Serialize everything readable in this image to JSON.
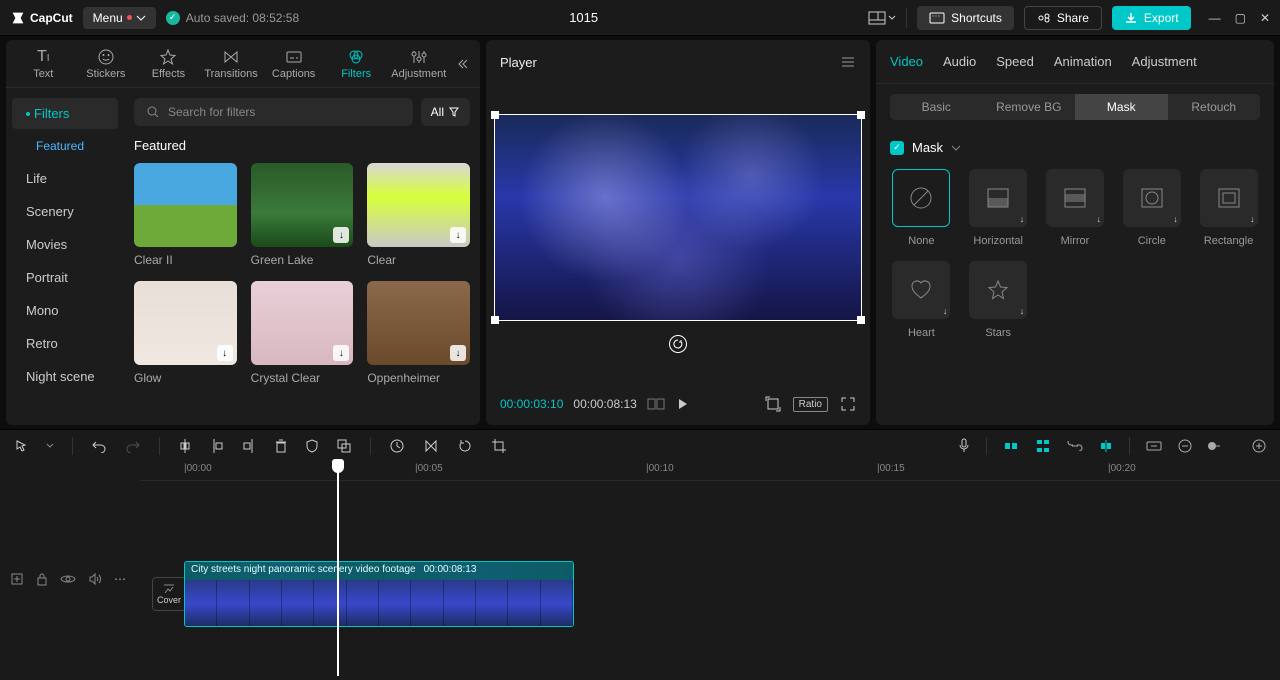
{
  "topbar": {
    "app_name": "CapCut",
    "menu_label": "Menu",
    "autosave_label": "Auto saved: 08:52:58",
    "project_title": "1015",
    "shortcuts_label": "Shortcuts",
    "share_label": "Share",
    "export_label": "Export"
  },
  "media_tabs": [
    {
      "label": "Text"
    },
    {
      "label": "Stickers"
    },
    {
      "label": "Effects"
    },
    {
      "label": "Transitions"
    },
    {
      "label": "Captions"
    },
    {
      "label": "Filters"
    },
    {
      "label": "Adjustment"
    }
  ],
  "filter_categories": {
    "main": "Filters",
    "items": [
      "Featured",
      "Life",
      "Scenery",
      "Movies",
      "Portrait",
      "Mono",
      "Retro",
      "Night scene"
    ]
  },
  "search": {
    "placeholder": "Search for filters",
    "all_label": "All"
  },
  "filter_section_title": "Featured",
  "filters": [
    {
      "name": "Clear II",
      "bg": "linear-gradient(180deg,#4aa8e0 0%,#4aa8e0 50%,#6daa3a 50%,#6daa3a 100%)",
      "dl": false
    },
    {
      "name": "Green Lake",
      "bg": "linear-gradient(180deg,#2a5a2a 0%,#3a7a3a 60%,#1a4a1a 100%)",
      "dl": true
    },
    {
      "name": "Clear",
      "bg": "linear-gradient(180deg,#d8d8d8 0%,#d8ff3a 40%,#c8c8c8 100%)",
      "dl": true
    },
    {
      "name": "Glow",
      "bg": "linear-gradient(180deg,#e8e0d8 0%,#f0e8e0 100%)",
      "dl": true
    },
    {
      "name": "Crystal Clear",
      "bg": "linear-gradient(180deg,#e8d0d8 0%,#d8b8c0 100%)",
      "dl": true
    },
    {
      "name": "Oppenheimer",
      "bg": "linear-gradient(180deg,#8a6a4a 0%,#6a4a2a 100%)",
      "dl": true
    }
  ],
  "player": {
    "title": "Player",
    "current_time": "00:00:03:10",
    "total_time": "00:00:08:13",
    "ratio_label": "Ratio"
  },
  "right_panel": {
    "tabs": [
      "Video",
      "Audio",
      "Speed",
      "Animation",
      "Adjustment"
    ],
    "subtabs": [
      "Basic",
      "Remove BG",
      "Mask",
      "Retouch"
    ],
    "mask_label": "Mask",
    "mask_shapes": [
      {
        "name": "None",
        "active": true
      },
      {
        "name": "Horizontal"
      },
      {
        "name": "Mirror"
      },
      {
        "name": "Circle"
      },
      {
        "name": "Rectangle"
      },
      {
        "name": "Heart"
      },
      {
        "name": "Stars"
      }
    ]
  },
  "timeline": {
    "marks": [
      "00:00",
      "00:05",
      "00:10",
      "00:15",
      "00:20"
    ],
    "cover_label": "Cover",
    "clip": {
      "title": "City streets night panoramic scenery video footage",
      "duration": "00:00:08:13"
    }
  }
}
